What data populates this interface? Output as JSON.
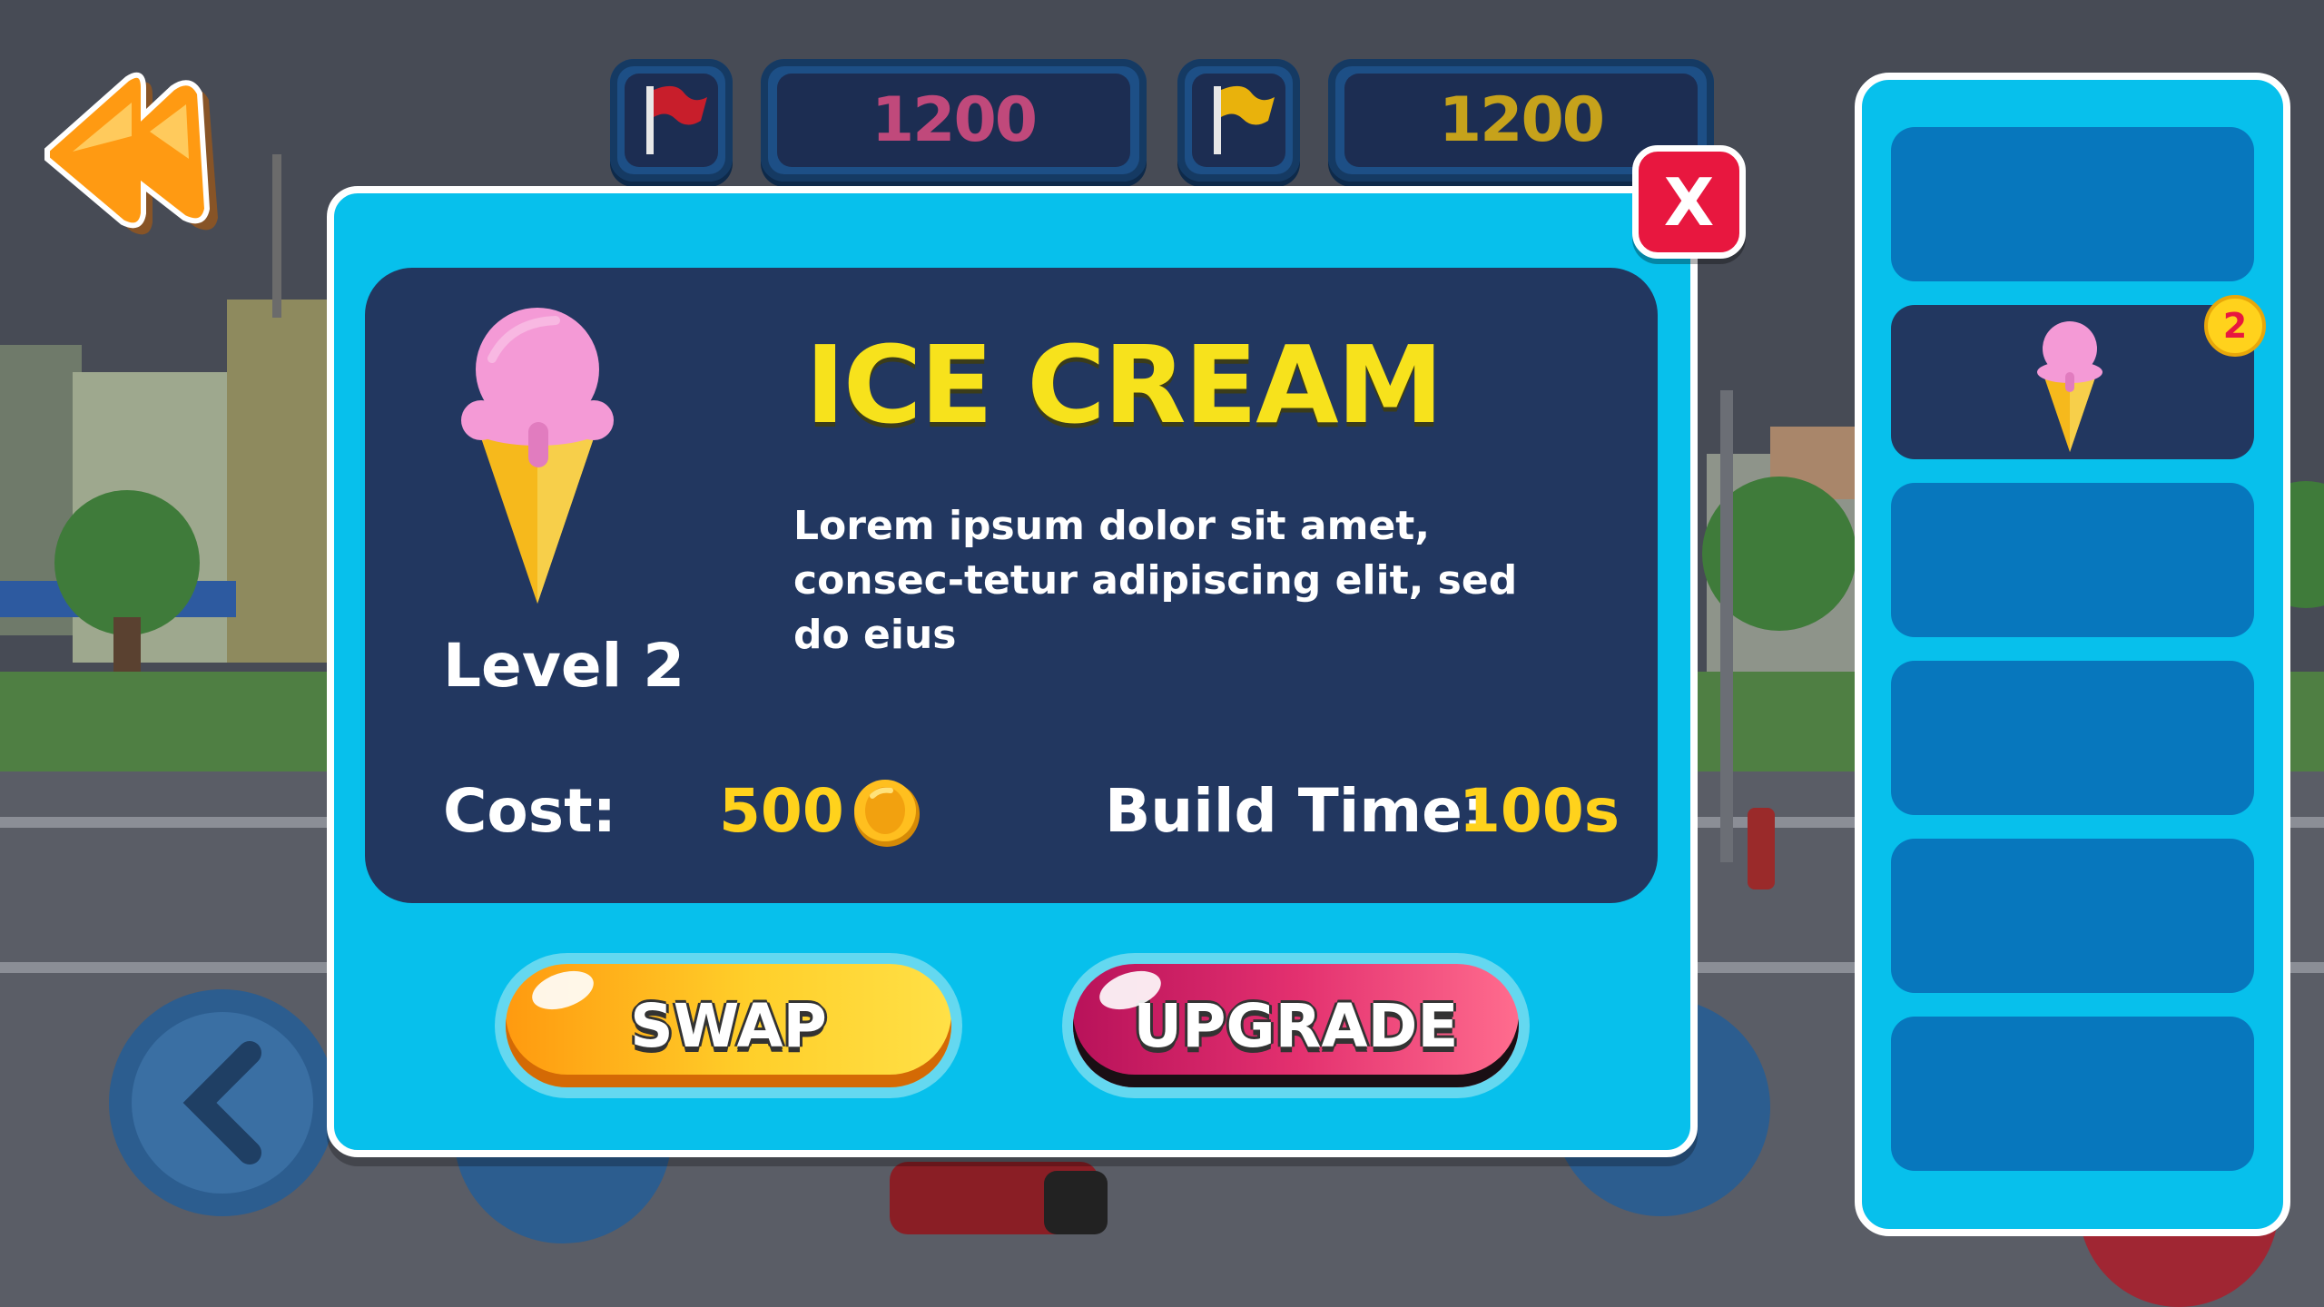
{
  "hud": {
    "red_score": "1200",
    "yellow_score": "1200",
    "red_flag_icon": "red-flag-icon",
    "yellow_flag_icon": "yellow-flag-icon",
    "back_icon": "double-arrow-left-icon"
  },
  "dialog": {
    "close_label": "X",
    "item_name": "ICE CREAM",
    "item_icon": "ice-cream-cone-icon",
    "level": "Level 2",
    "description": "Lorem ipsum dolor sit amet, consec-tetur adipiscing elit, sed do eius",
    "cost_label": "Cost:",
    "cost_value": "500",
    "build_time_label": "Build Time:",
    "build_time_value": "100s",
    "swap_label": "SWAP",
    "upgrade_label": "UPGRADE"
  },
  "inventory": {
    "slots": [
      {
        "state": "empty"
      },
      {
        "state": "filled",
        "item": "ice-cream-cone-icon",
        "badge": "2"
      },
      {
        "state": "empty"
      },
      {
        "state": "empty"
      },
      {
        "state": "empty"
      },
      {
        "state": "empty"
      }
    ]
  },
  "colors": {
    "panel_cyan": "#07c0ec",
    "panel_navy": "#223760",
    "title_yellow": "#f7e21c",
    "close_red": "#e8173f",
    "swap_orange": "#ff9a0f",
    "upgrade_pink": "#e3306f"
  }
}
